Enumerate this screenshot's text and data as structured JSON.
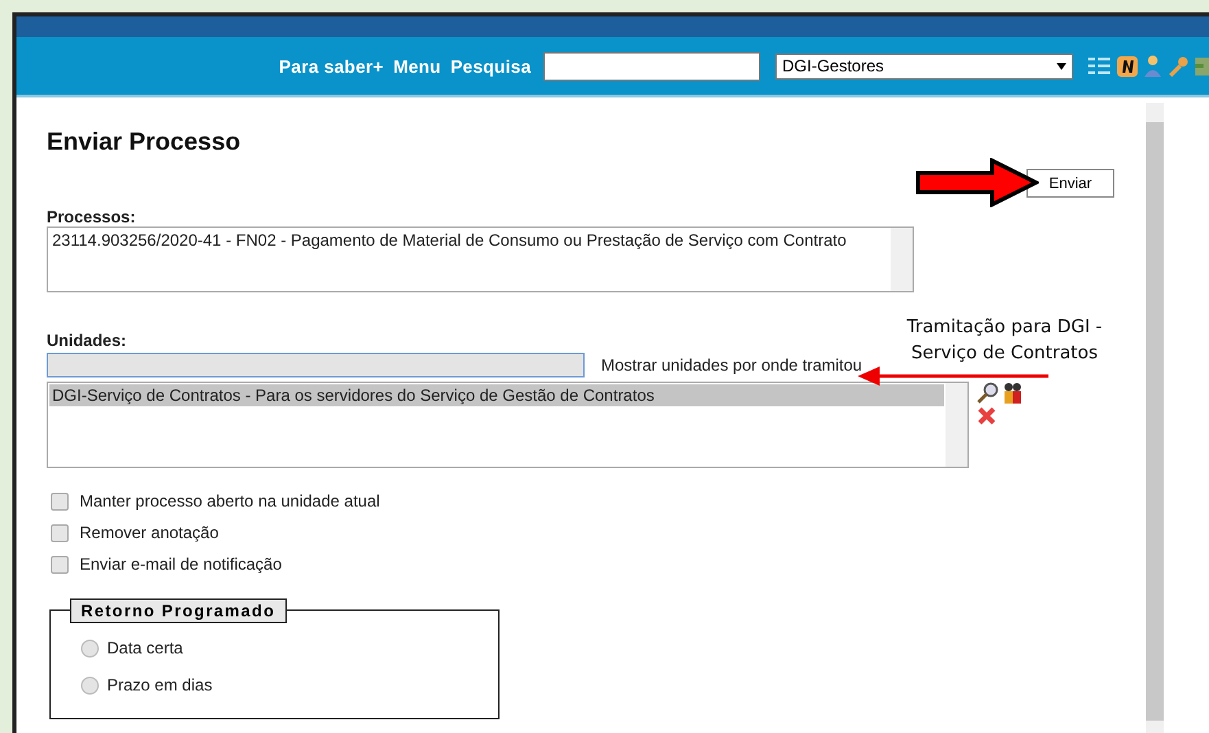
{
  "header": {
    "links": [
      "Para saber+",
      "Menu",
      "Pesquisa"
    ],
    "unit_select": "DGI-Gestores"
  },
  "page_title": "Enviar Processo",
  "send_button": "Enviar",
  "processes": {
    "label": "Processos:",
    "items": [
      {
        "text": "23114.903256/2020-41 - FN02 - Pagamento de Material de Consumo ou Prestação de Serviço com Contrato",
        "selected": false
      }
    ]
  },
  "units": {
    "label": "Unidades:",
    "show_link": "Mostrar unidades por onde tramitou",
    "items": [
      {
        "text": "DGI-Serviço de Contratos - Para os servidores do Serviço de Gestão de Contratos",
        "selected": true
      }
    ]
  },
  "options": [
    {
      "label": "Manter processo aberto na unidade atual",
      "checked": false
    },
    {
      "label": "Remover anotação",
      "checked": false
    },
    {
      "label": "Enviar e-mail de notificação",
      "checked": false
    }
  ],
  "scheduled_return": {
    "legend": "Retorno Programado",
    "options": [
      {
        "label": "Data certa",
        "selected": false
      },
      {
        "label": "Prazo em dias",
        "selected": false
      }
    ]
  },
  "annotation": {
    "lines": [
      "Tramitação para DGI -",
      "Serviço de Contratos"
    ]
  }
}
